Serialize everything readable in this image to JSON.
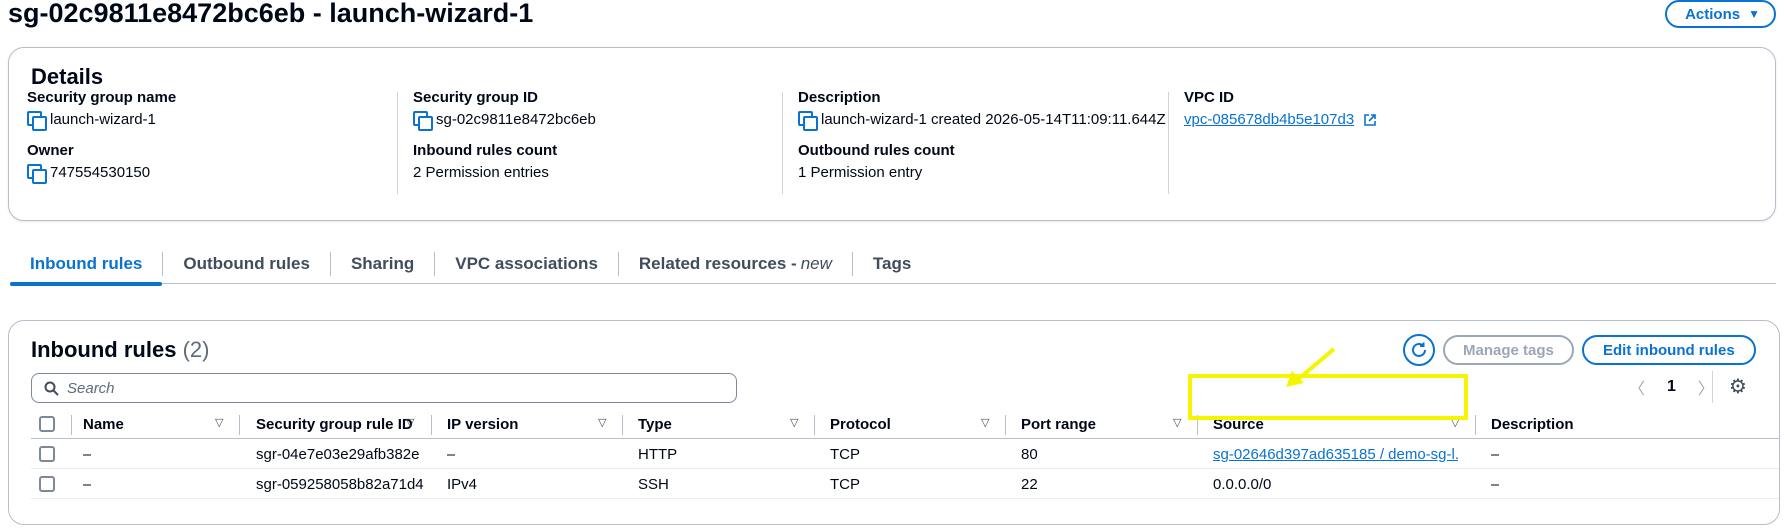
{
  "page": {
    "title": "sg-02c9811e8472bc6eb - launch-wizard-1",
    "actions_label": "Actions",
    "actions_caret": "▼"
  },
  "details": {
    "heading": "Details",
    "fields": {
      "sg_name": {
        "label": "Security group name",
        "value": "launch-wizard-1"
      },
      "sg_id": {
        "label": "Security group ID",
        "value": "sg-02c9811e8472bc6eb"
      },
      "description": {
        "label": "Description",
        "value": "launch-wizard-1 created 2026-05-14T11:09:11.644Z"
      },
      "vpc_id": {
        "label": "VPC ID",
        "value": "vpc-085678db4b5e107d3"
      },
      "owner": {
        "label": "Owner",
        "value": "747554530150"
      },
      "inbound_count": {
        "label": "Inbound rules count",
        "value": "2 Permission entries"
      },
      "outbound_count": {
        "label": "Outbound rules count",
        "value": "1 Permission entry"
      }
    }
  },
  "tabs": [
    {
      "label": "Inbound rules",
      "active": true
    },
    {
      "label": "Outbound rules"
    },
    {
      "label": "Sharing"
    },
    {
      "label": "VPC associations"
    },
    {
      "label": "Related resources -",
      "badge": "new"
    },
    {
      "label": "Tags"
    }
  ],
  "rules_panel": {
    "heading": "Inbound rules",
    "count": "(2)",
    "manage_tags_label": "Manage tags",
    "edit_label": "Edit inbound rules",
    "search_placeholder": "Search",
    "page_number": "1",
    "prev": "〈",
    "next": "〉"
  },
  "table": {
    "columns": [
      "Name",
      "Security group rule ID",
      "IP version",
      "Type",
      "Protocol",
      "Port range",
      "Source",
      "Description"
    ],
    "rows": [
      {
        "name": "–",
        "rule_id": "sgr-04e7e03e29afb382e",
        "ip_version": "–",
        "type": "HTTP",
        "protocol": "TCP",
        "port_range": "80",
        "source": "sg-02646d397ad635185 / demo-sg-l...",
        "description": "–"
      },
      {
        "name": "–",
        "rule_id": "sgr-059258058b82a71d4",
        "ip_version": "IPv4",
        "type": "SSH",
        "protocol": "TCP",
        "port_range": "22",
        "source": "0.0.0.0/0",
        "description": "–"
      }
    ]
  },
  "colors": {
    "accent": "#0972d3",
    "highlight": "#f5f500"
  }
}
